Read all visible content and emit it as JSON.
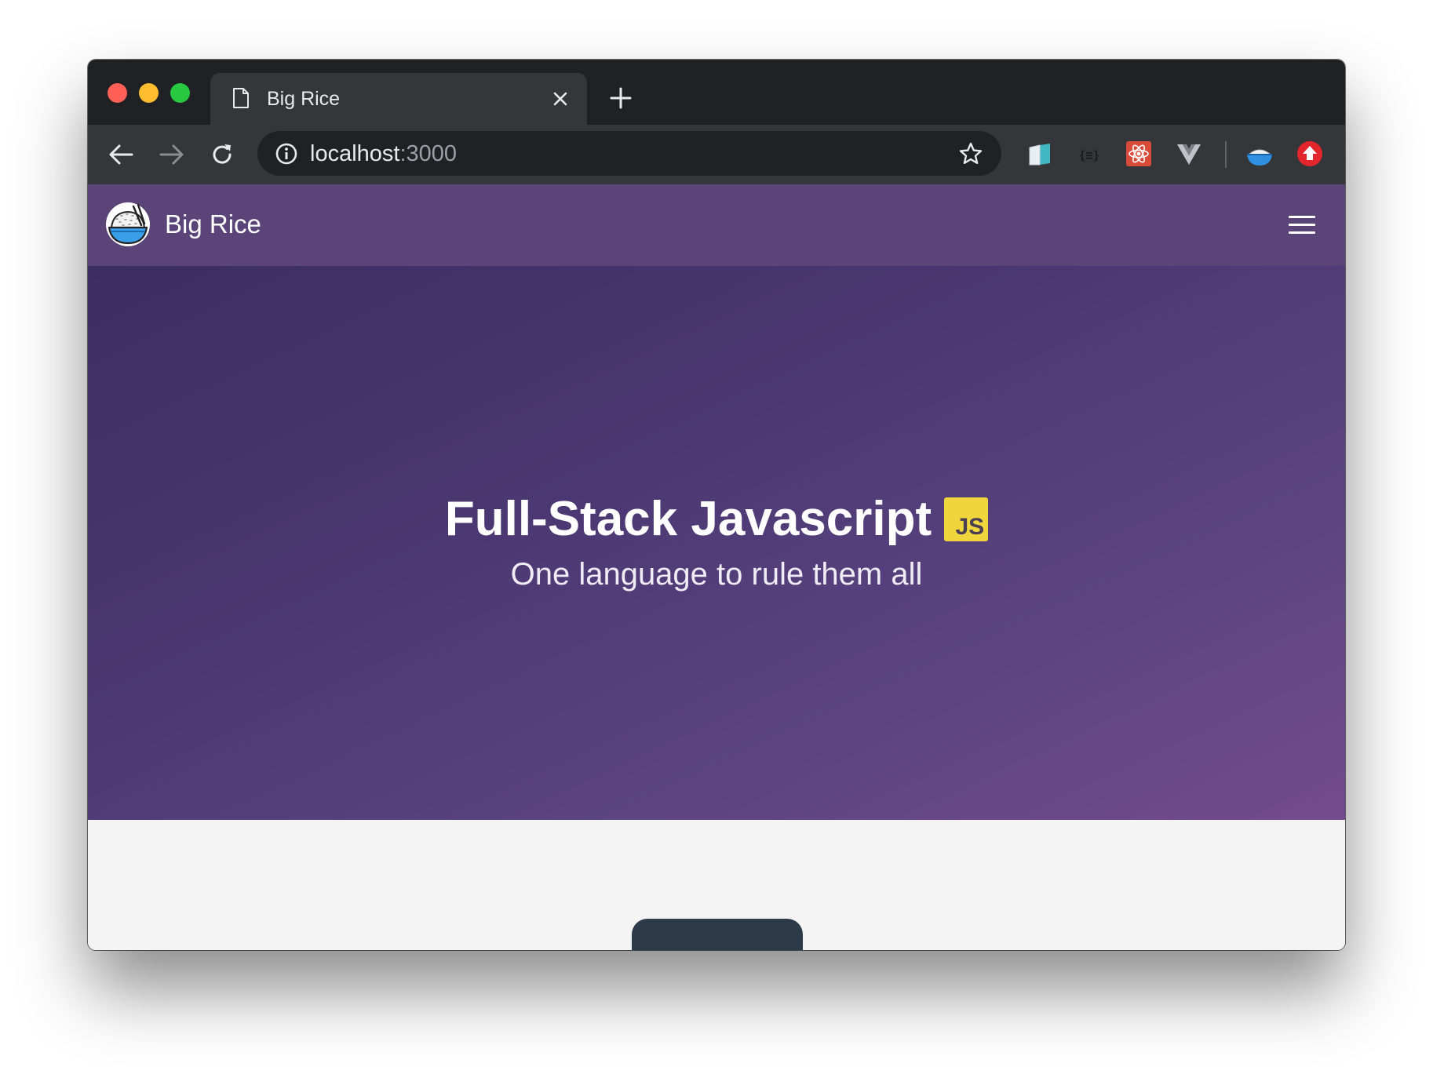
{
  "browser": {
    "tab": {
      "title": "Big Rice",
      "icon": "document-icon"
    },
    "new_tab_icon": "plus-icon",
    "toolbar": {
      "back_icon": "arrow-left-icon",
      "forward_icon": "arrow-right-icon",
      "reload_icon": "reload-icon",
      "address": {
        "host": "localhost",
        "port": ":3000",
        "info_icon": "info-icon",
        "bookmark_icon": "star-icon"
      },
      "extensions": [
        "book-extension-icon",
        "json-formatter-extension-icon",
        "react-devtools-extension-icon",
        "vue-devtools-extension-icon",
        "rice-bowl-extension-icon",
        "upload-extension-icon"
      ]
    }
  },
  "site": {
    "brand": {
      "name": "Big Rice",
      "logo": "rice-bowl-logo"
    },
    "menu_icon": "hamburger-menu-icon",
    "hero": {
      "title": "Full-Stack Javascript",
      "badge": "JS",
      "subtitle": "One language to rule them all"
    }
  },
  "colors": {
    "navbar": "#5a4478",
    "hero_gradient_start": "#3c2d62",
    "hero_gradient_end": "#744a8e",
    "js_badge": "#f0d53d",
    "page_background": "#f4f4f5"
  }
}
